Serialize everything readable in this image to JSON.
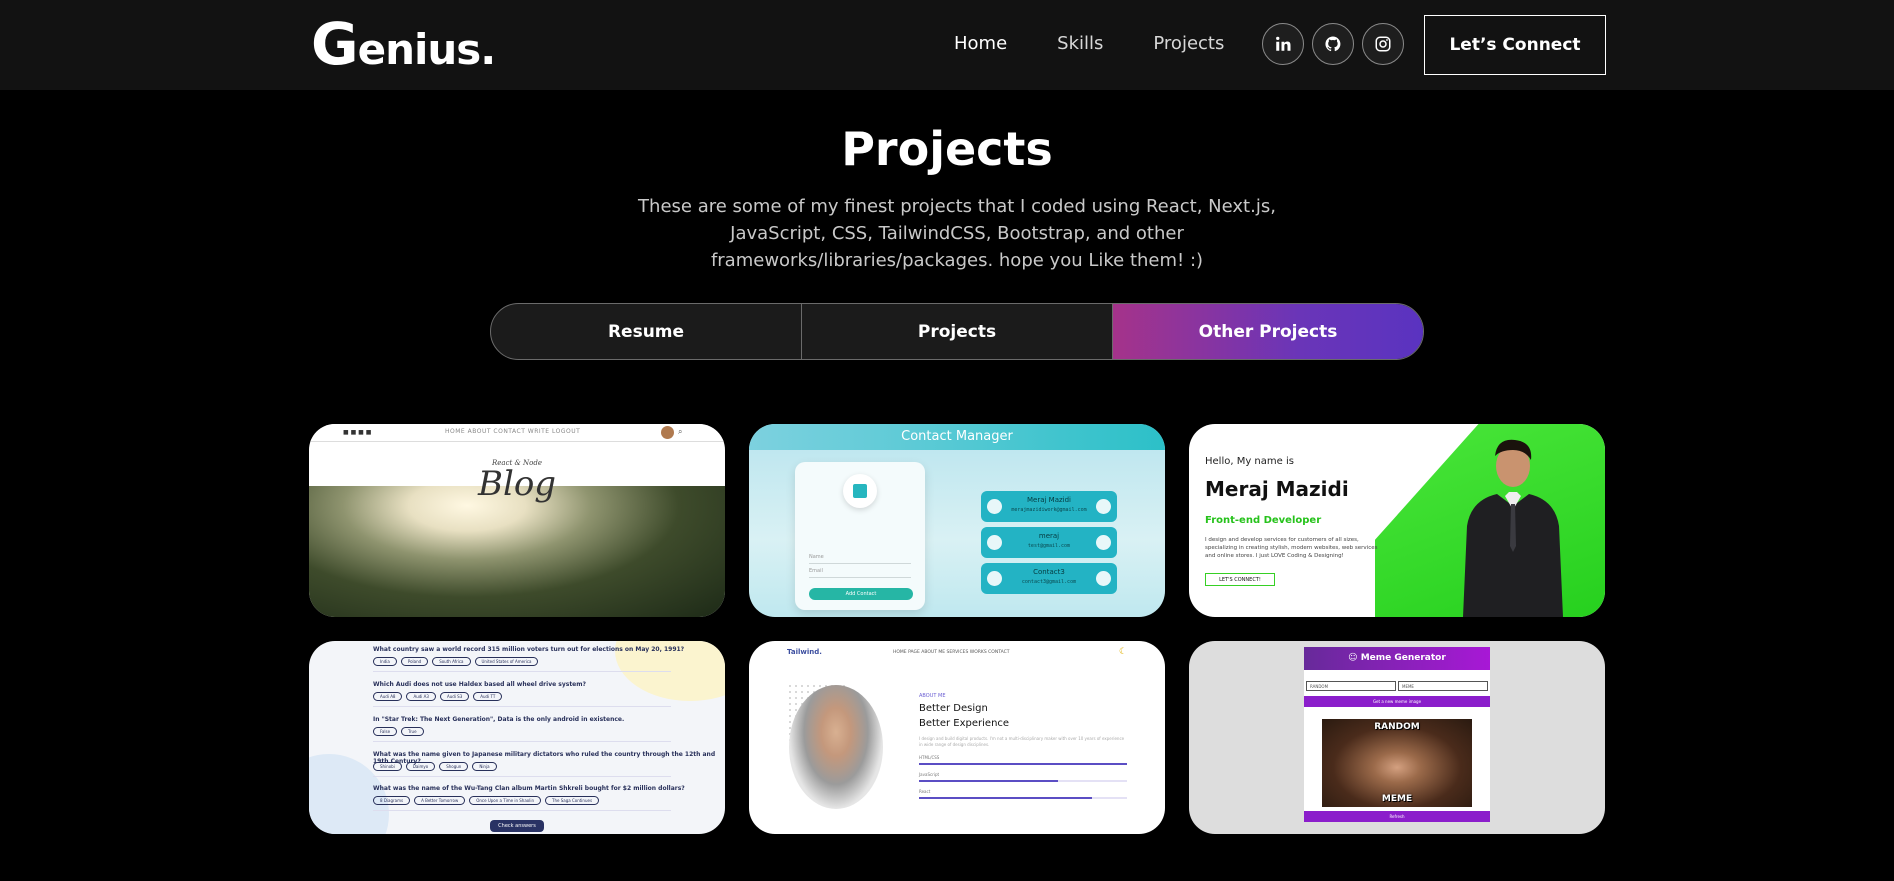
{
  "nav": {
    "logo_initial": "G",
    "logo_rest": "enius.",
    "links": [
      "Home",
      "Skills",
      "Projects"
    ],
    "socials": [
      "linkedin-icon",
      "github-icon",
      "instagram-icon"
    ],
    "connect_label": "Let’s Connect"
  },
  "header": {
    "title": "Projects",
    "description": "These are some of my finest projects that I coded using React, Next.js, JavaScript, CSS, TailwindCSS, Bootstrap, and other frameworks/libraries/packages. hope you Like them! :)"
  },
  "tabs": [
    {
      "label": "Resume"
    },
    {
      "label": "Projects"
    },
    {
      "label": "Other Projects",
      "active": true
    }
  ],
  "colors": {
    "accent_start": "#a5338a",
    "accent_end": "#5a33c0",
    "nav_bg": "#121212",
    "page_bg": "#000000"
  },
  "cards": {
    "blog": {
      "menu": "HOME   ABOUT   CONTACT   WRITE   LOGOUT",
      "subtitle": "React & Node",
      "title": "Blog"
    },
    "contact": {
      "header": "Contact Manager",
      "fields": [
        "Name",
        "Email"
      ],
      "button": "Add Contact",
      "contacts": [
        {
          "name": "Meraj Mazidi",
          "email": "merajmazidiwork@gmail.com"
        },
        {
          "name": "meraj",
          "email": "test@gmail.com"
        },
        {
          "name": "Contact3",
          "email": "contact3@gmail.com"
        }
      ]
    },
    "portfolio": {
      "hello": "Hello, My name is",
      "name": "Meraj Mazidi",
      "role": "Front-end Developer",
      "text": "I design and develop services for customers of all sizes, specializing in creating stylish, modern websites, web services and online stores. I just LOVE Coding & Designing!",
      "button": "LET'S CONNECT!"
    },
    "quiz": {
      "questions": [
        {
          "q": "What country saw a world record 315 million voters turn out for elections on May 20, 1991?",
          "opts": [
            "India",
            "Poland",
            "South Africa",
            "United States of America"
          ]
        },
        {
          "q": "Which Audi does not use Haldex based all wheel drive system?",
          "opts": [
            "Audi A8",
            "Audi A3",
            "Audi S3",
            "Audi TT"
          ]
        },
        {
          "q": "In \"Star Trek: The Next Generation\", Data is the only android in existence.",
          "opts": [
            "False",
            "True"
          ]
        },
        {
          "q": "What was the name given to Japanese military dictators who ruled the country through the 12th and 19th Century?",
          "opts": [
            "Shinobi",
            "Daimyo",
            "Shogun",
            "Ninja"
          ]
        },
        {
          "q": "What was the name of the Wu-Tang Clan album Martin Shkreli bought for $2 million dollars?",
          "opts": [
            "8 Diagrams",
            "A Better Tomorrow",
            "Once Upon a Time in Shaolin",
            "The Saga Continues"
          ]
        }
      ],
      "button": "Check answers"
    },
    "tailwind": {
      "logo": "Tailwind.",
      "menu": "HOME PAGE    ABOUT ME    SERVICES    WORKS    CONTACT",
      "about": "ABOUT ME",
      "heading1": "Better Design",
      "heading2": "Better Experience",
      "text": "I design and build digital products. I'm not a multi-disciplinary maker with over 10 years of experience in wide range of design disciplines.",
      "skills": [
        {
          "label": "HTML/CSS",
          "pct": 100
        },
        {
          "label": "JavaScript",
          "pct": 67
        },
        {
          "label": "React",
          "pct": 83
        }
      ]
    },
    "meme": {
      "title": "Meme Generator",
      "input_top": "RANDOM",
      "input_bottom": "MEME",
      "get_button": "Get a new meme image",
      "top_text": "RANDOM",
      "bottom_text": "MEME",
      "refresh": "Refresh"
    }
  }
}
